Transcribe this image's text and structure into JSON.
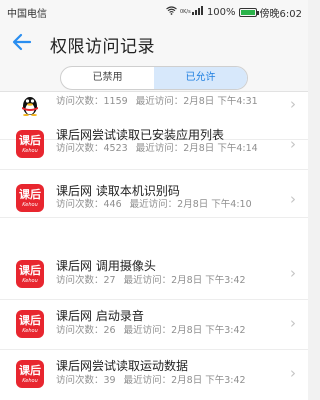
{
  "status": {
    "carrier": "中国电信",
    "net_speed": "0K/s",
    "battery_percent": "100%",
    "battery_level": 1.0,
    "time": "傍晚6:02"
  },
  "header": {
    "title": "权限访问记录"
  },
  "tabs": [
    {
      "label": "已禁用",
      "active": false
    },
    {
      "label": "已允许",
      "active": true
    }
  ],
  "records": [
    {
      "icon": "qq-penguin-icon",
      "app": "",
      "count_label": "访问次数：",
      "count": "1159",
      "last_label": "最近访问：",
      "last": "2月8日 下午4:31"
    },
    {
      "icon": "kehou-app-icon",
      "app": "课后网尝试读取已安装应用列表",
      "count_label": "访问次数：",
      "count": "4523",
      "last_label": "最近访问：",
      "last": "2月8日 下午4:14"
    },
    {
      "icon": "kehou-app-icon",
      "app": "课后网 读取本机识别码",
      "count_label": "访问次数：",
      "count": "446",
      "last_label": "最近访问：",
      "last": "2月8日 下午4:10"
    },
    {
      "icon": "kehou-app-icon",
      "app": "课后网 调用摄像头",
      "count_label": "访问次数：",
      "count": "27",
      "last_label": "最近访问：",
      "last": "2月8日 下午3:42"
    },
    {
      "icon": "kehou-app-icon",
      "app": "课后网 启动录音",
      "count_label": "访问次数：",
      "count": "26",
      "last_label": "最近访问：",
      "last": "2月8日 下午3:42"
    },
    {
      "icon": "kehou-app-icon",
      "app": "课后网尝试读取运动数据",
      "count_label": "访问次数：",
      "count": "39",
      "last_label": "最近访问：",
      "last": "2月8日 下午3:42"
    }
  ],
  "app_icon": {
    "cn": "课后",
    "en": "Kehou"
  },
  "colors": {
    "accent": "#2a8ef0",
    "app_red": "#e8262f",
    "tab_active_bg": "#d7e8fb"
  }
}
